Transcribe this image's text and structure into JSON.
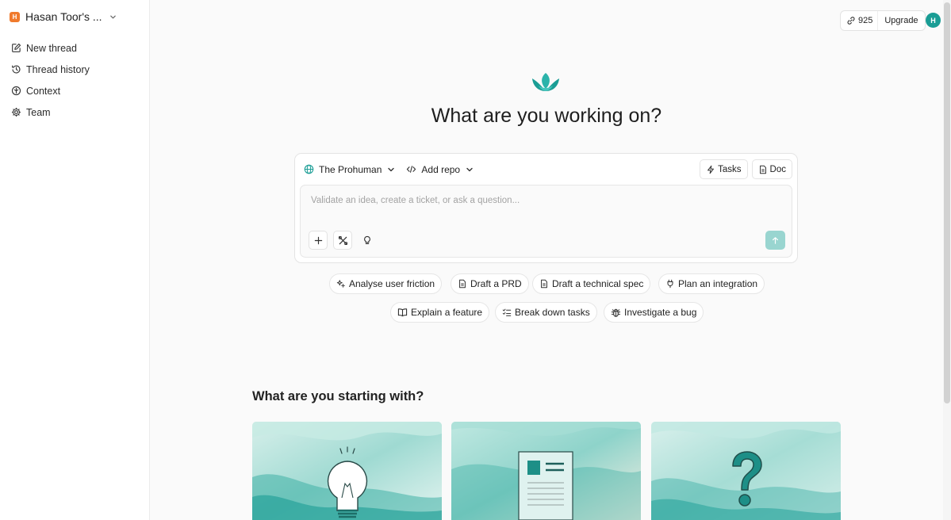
{
  "sidebar": {
    "workspace_initial": "H",
    "workspace_name": "Hasan Toor's ...",
    "items": [
      {
        "label": "New thread",
        "icon": "edit-icon"
      },
      {
        "label": "Thread history",
        "icon": "history-icon"
      },
      {
        "label": "Context",
        "icon": "context-icon"
      },
      {
        "label": "Team",
        "icon": "team-icon"
      }
    ]
  },
  "header": {
    "credits": "925",
    "upgrade_label": "Upgrade",
    "avatar_initial": "H"
  },
  "hero": {
    "title": "What are you working on?"
  },
  "composer": {
    "project": "The Prohuman",
    "repo": "Add repo",
    "tasks_label": "Tasks",
    "doc_label": "Doc",
    "placeholder": "Validate an idea, create a ticket, or ask a question..."
  },
  "suggestions": [
    {
      "label": "Analyse user friction",
      "icon": "sparkle-icon"
    },
    {
      "label": "Draft a PRD",
      "icon": "document-icon"
    },
    {
      "label": "Draft a technical spec",
      "icon": "document-icon"
    },
    {
      "label": "Plan an integration",
      "icon": "plug-icon"
    },
    {
      "label": "Explain a feature",
      "icon": "book-icon"
    },
    {
      "label": "Break down tasks",
      "icon": "checklist-icon"
    },
    {
      "label": "Investigate a bug",
      "icon": "bug-icon"
    }
  ],
  "starting": {
    "title": "What are you starting with?",
    "cards": [
      {
        "icon": "lightbulb-icon"
      },
      {
        "icon": "document-icon"
      },
      {
        "icon": "question-mark-icon"
      }
    ]
  },
  "colors": {
    "accent": "#1a9d95",
    "send_button": "#99d5d0",
    "workspace_badge": "#f07a2c"
  }
}
